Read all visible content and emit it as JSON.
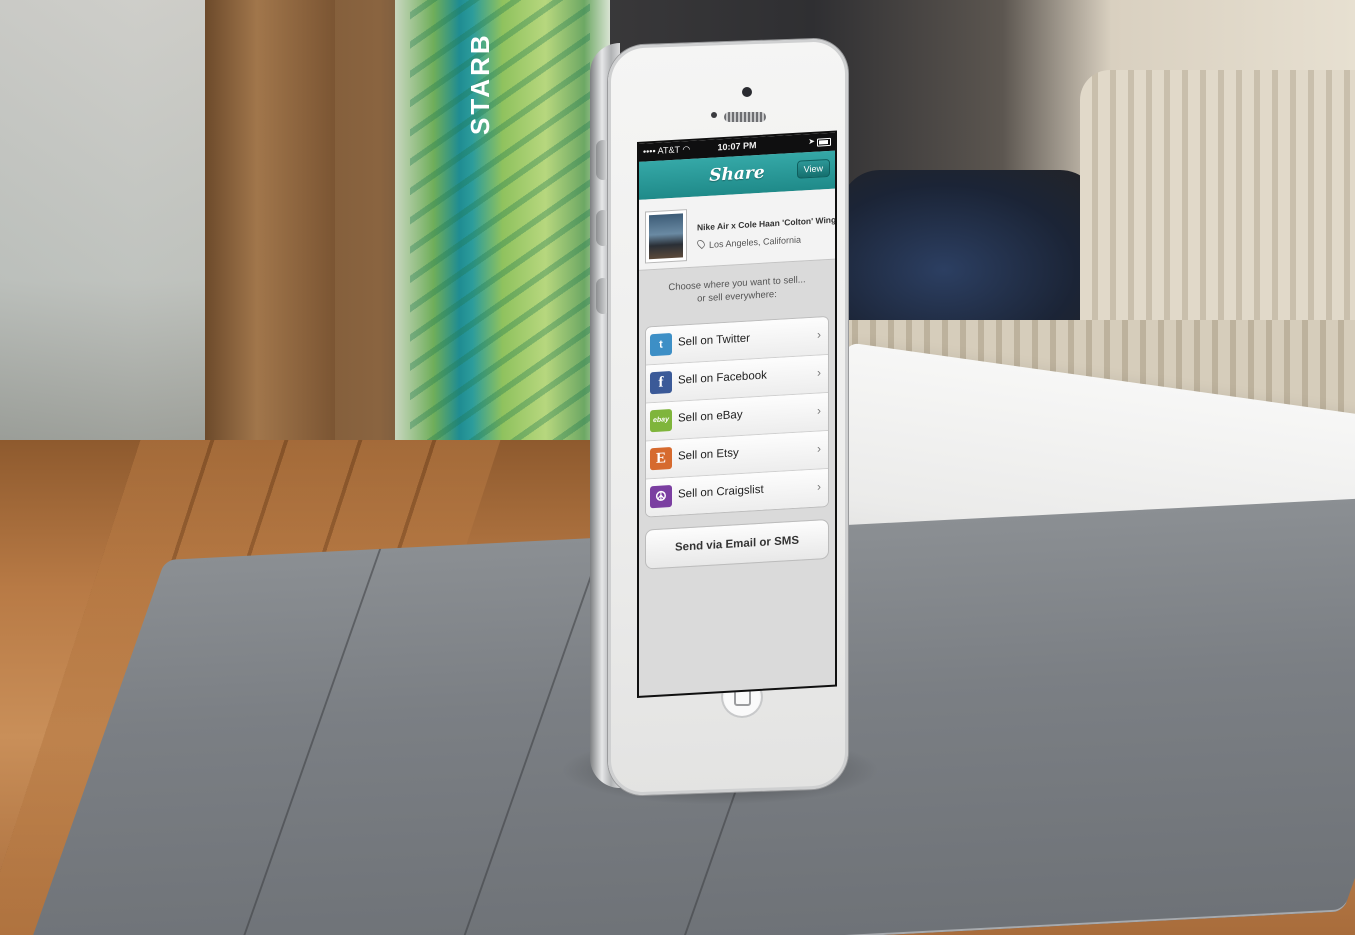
{
  "status_bar": {
    "carrier": "AT&T",
    "time": "10:07 PM"
  },
  "nav": {
    "title": "Share",
    "view_button": "View"
  },
  "item": {
    "title": "Nike Air x Cole Haan 'Colton' Wingtips",
    "location": "Los Angeles, California"
  },
  "prompt": {
    "line1": "Choose where you want to sell...",
    "line2": "or sell everywhere:"
  },
  "options": [
    {
      "label": "Sell on Twitter",
      "icon": "twitter-icon"
    },
    {
      "label": "Sell on Facebook",
      "icon": "facebook-icon"
    },
    {
      "label": "Sell on eBay",
      "icon": "ebay-icon"
    },
    {
      "label": "Sell on Etsy",
      "icon": "etsy-icon"
    },
    {
      "label": "Sell on Craigslist",
      "icon": "craigslist-icon"
    }
  ],
  "send_button": "Send via Email or SMS",
  "background": {
    "cup_text": "STARB"
  },
  "colors": {
    "accent": "#1f8a89",
    "twitter": "#3d8fc6",
    "facebook": "#3b5a98",
    "ebay": "#7fb53c",
    "etsy": "#d66a2e",
    "craigslist": "#7b3fa1"
  }
}
